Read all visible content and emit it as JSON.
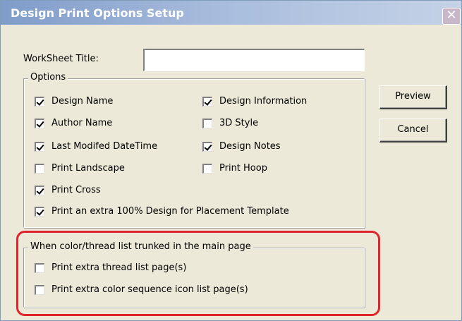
{
  "window": {
    "title": "Design Print Options Setup",
    "close_glyph": "✕"
  },
  "worksheet_title": {
    "label": "WorkSheet Title:",
    "value": ""
  },
  "options_group": {
    "caption": "Options",
    "items": [
      {
        "label": "Design Name",
        "checked": true
      },
      {
        "label": "Design Information",
        "checked": true
      },
      {
        "label": "Author Name",
        "checked": true
      },
      {
        "label": "3D Style",
        "checked": false
      },
      {
        "label": "Last Modifed DateTime",
        "checked": true
      },
      {
        "label": "Design Notes",
        "checked": true
      },
      {
        "label": "Print Landscape",
        "checked": false
      },
      {
        "label": "Print Hoop",
        "checked": false
      },
      {
        "label": "Print Cross",
        "checked": true
      },
      {
        "label": "Print an extra 100% Design for Placement Template",
        "checked": true
      }
    ]
  },
  "thread_group": {
    "caption": "When color/thread list trunked in the main page",
    "items": [
      {
        "label": "Print extra thread list page(s)",
        "checked": false
      },
      {
        "label": "Print extra color sequence icon list page(s)",
        "checked": false
      }
    ]
  },
  "buttons": {
    "preview": "Preview",
    "cancel": "Cancel"
  },
  "colors": {
    "highlight": "#e0242c",
    "dialog_bg": "#ece9d8",
    "titlebar": "#7f9cc9"
  }
}
